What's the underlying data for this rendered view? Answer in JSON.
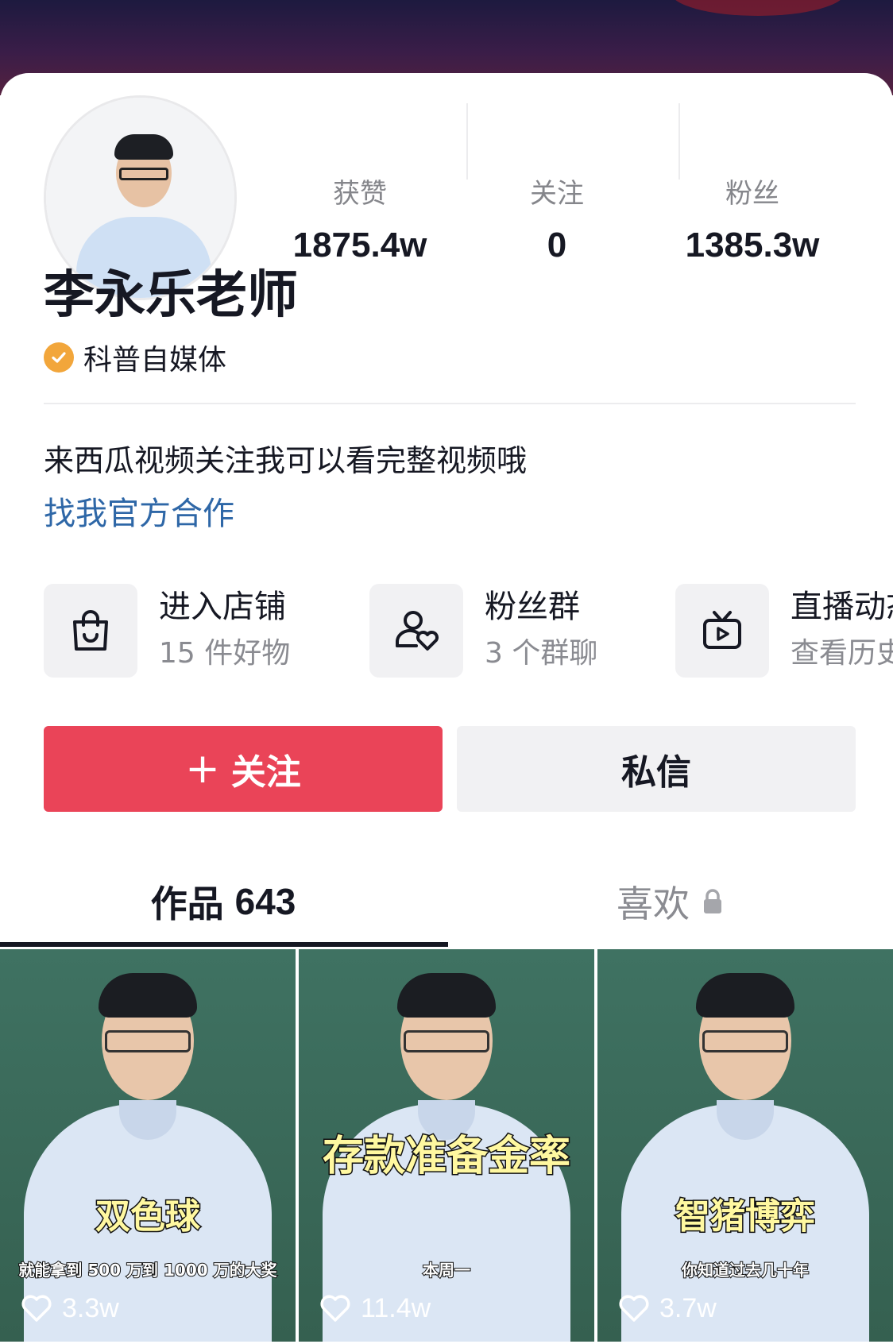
{
  "profile": {
    "name": "李永乐老师",
    "verified_label": "科普自媒体",
    "bio": "来西瓜视频关注我可以看完整视频哦",
    "link_text": "找我官方合作"
  },
  "stats": [
    {
      "label": "获赞",
      "value": "1875.4w"
    },
    {
      "label": "关注",
      "value": "0"
    },
    {
      "label": "粉丝",
      "value": "1385.3w"
    }
  ],
  "features": [
    {
      "title": "进入店铺",
      "subtitle": "15 件好物",
      "icon": "shopping-bag-icon"
    },
    {
      "title": "粉丝群",
      "subtitle": "3 个群聊",
      "icon": "fan-group-icon"
    },
    {
      "title": "直播动态",
      "subtitle": "查看历史",
      "icon": "live-tv-icon"
    }
  ],
  "actions": {
    "follow_plus": "+",
    "follow_label": "关注",
    "message_label": "私信"
  },
  "tabs": {
    "works_label": "作品",
    "works_count": "643",
    "likes_label": "喜欢"
  },
  "videos": [
    {
      "caption": "双色球",
      "subtitle": "就能拿到 500 万到 1000 万的大奖",
      "likes": "3.3w"
    },
    {
      "caption": "存款准备金率",
      "subtitle": "本周一",
      "likes": "11.4w"
    },
    {
      "caption": "智猪博弈",
      "subtitle": "你知道过去几十年",
      "likes": "3.7w"
    }
  ],
  "colors": {
    "follow_button": "#ea4458",
    "link": "#2e67a7",
    "verified_badge": "#f2a63b"
  }
}
